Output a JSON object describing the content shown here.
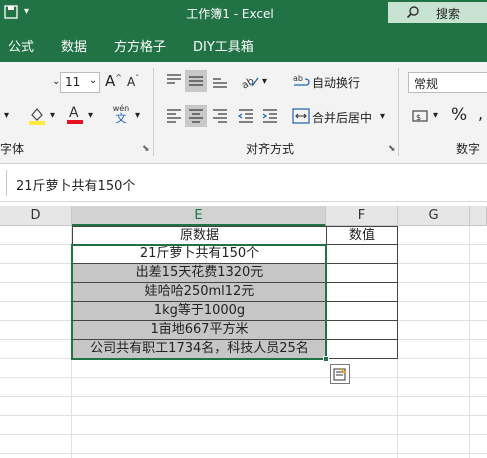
{
  "window": {
    "title": "工作簿1 - Excel",
    "search_label": "搜索"
  },
  "ribbon_tabs": [
    "公式",
    "数据",
    "方方格子",
    "DIY工具箱"
  ],
  "font": {
    "size": "11",
    "group_label": "字体",
    "pinyin_top": "wén",
    "pinyin_bottom": "文"
  },
  "alignment": {
    "wrap_label": "自动换行",
    "merge_label": "合并后居中",
    "group_label": "对齐方式"
  },
  "number": {
    "format": "常规",
    "percent": "%",
    "group_label": "数字"
  },
  "formula_bar": {
    "content": "21斤萝卜共有150个"
  },
  "columns": [
    "D",
    "E",
    "F",
    "G"
  ],
  "table": {
    "header_source": "原数据",
    "header_value": "数值",
    "rows": [
      "21斤萝卜共有150个",
      "出差15天花费1320元",
      "娃哈哈250ml12元",
      "1kg等于1000g",
      "1亩地667平方米",
      "公司共有职工1734名，科技人员25名"
    ]
  },
  "colors": {
    "excel_green": "#217346",
    "selection_fill": "#c6c6c6",
    "selection_border": "#217346",
    "font_color": "#e81123",
    "highlight": "#ffeb3b"
  }
}
